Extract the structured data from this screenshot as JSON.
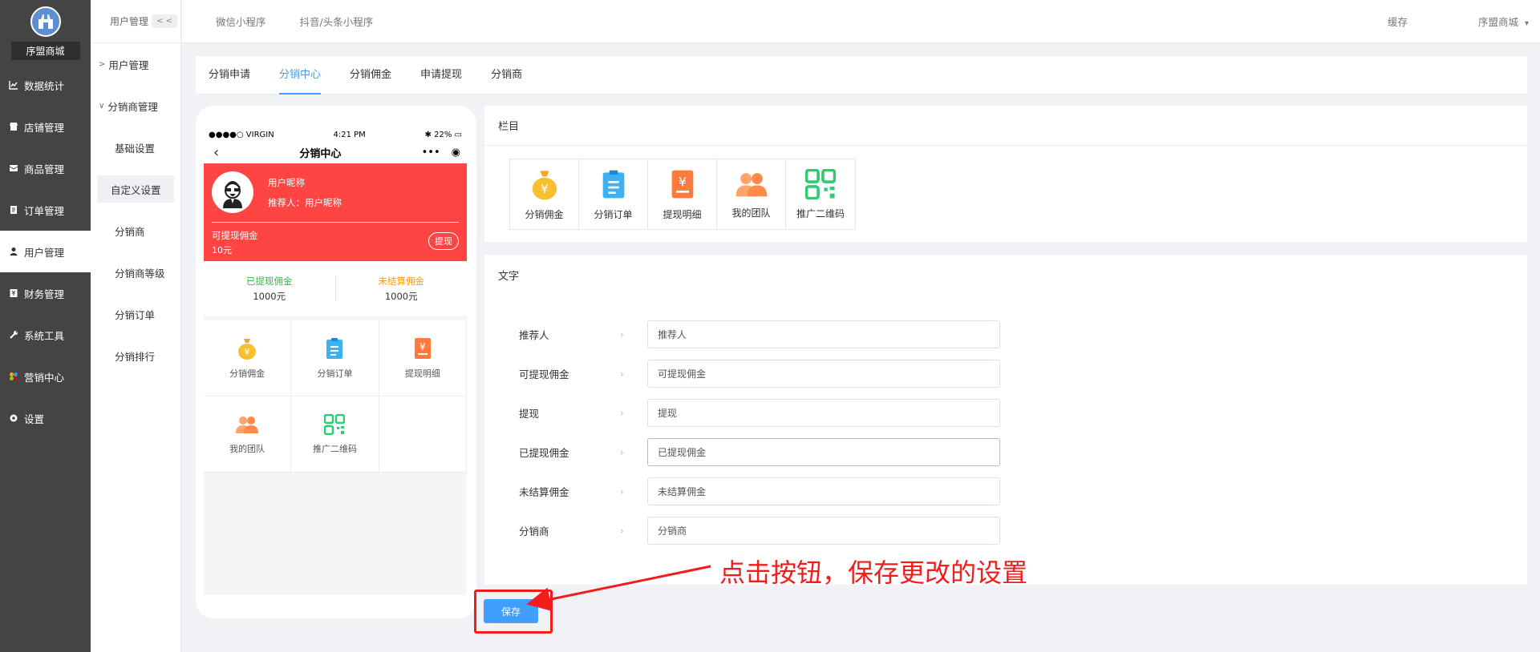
{
  "brand": {
    "name": "序盟商城"
  },
  "sidebar": {
    "items": [
      {
        "label": "数据统计",
        "icon": "chart-line-icon"
      },
      {
        "label": "店铺管理",
        "icon": "store-icon"
      },
      {
        "label": "商品管理",
        "icon": "product-icon"
      },
      {
        "label": "订单管理",
        "icon": "order-icon"
      },
      {
        "label": "用户管理",
        "icon": "user-icon"
      },
      {
        "label": "财务管理",
        "icon": "finance-icon"
      },
      {
        "label": "系统工具",
        "icon": "wrench-icon"
      },
      {
        "label": "营销中心",
        "icon": "marketing-icon"
      },
      {
        "label": "设置",
        "icon": "gear-icon"
      }
    ]
  },
  "subbar": {
    "header": "用户管理",
    "collapse": "< <",
    "groups": [
      {
        "label": "用户管理",
        "chevron": ">"
      },
      {
        "label": "分销商管理",
        "chevron": "∨"
      }
    ],
    "items": [
      "基础设置",
      "自定义设置",
      "分销商",
      "分销商等级",
      "分销订单",
      "分销排行"
    ]
  },
  "topbar": {
    "links": [
      "微信小程序",
      "抖音/头条小程序"
    ],
    "cache": "缓存",
    "store": "序盟商城"
  },
  "tabs": [
    "分销申请",
    "分销中心",
    "分销佣金",
    "申请提现",
    "分销商"
  ],
  "phone": {
    "carrier": "●●●●○ VIRGIN",
    "time": "4:21 PM",
    "battery": "22%",
    "title": "分销中心",
    "user_name": "用户昵称",
    "referrer": "推荐人：用户昵称",
    "can_withdraw_label": "可提现佣金",
    "can_withdraw_value": "10元",
    "withdraw_btn": "提现",
    "withdrawn_label": "已提现佣金",
    "withdrawn_value": "1000元",
    "unsettled_label": "未结算佣金",
    "unsettled_value": "1000元",
    "grid": [
      "分销佣金",
      "分销订单",
      "提现明细",
      "我的团队",
      "推广二维码"
    ]
  },
  "columns_panel": {
    "title": "栏目",
    "items": [
      "分销佣金",
      "分销订单",
      "提现明细",
      "我的团队",
      "推广二维码"
    ]
  },
  "text_panel": {
    "title": "文字",
    "fields": [
      {
        "label": "推荐人",
        "value": "推荐人"
      },
      {
        "label": "可提现佣金",
        "value": "可提现佣金"
      },
      {
        "label": "提现",
        "value": "提现"
      },
      {
        "label": "已提现佣金",
        "value": "已提现佣金"
      },
      {
        "label": "未结算佣金",
        "value": "未结算佣金"
      },
      {
        "label": "分销商",
        "value": "分销商"
      }
    ]
  },
  "save_label": "保存",
  "annotation": "点击按钮，保存更改的设置",
  "colors": {
    "accent": "#409eff",
    "red_card": "#ff4444",
    "annotation": "#f21c1c",
    "sidebar": "#444444"
  }
}
